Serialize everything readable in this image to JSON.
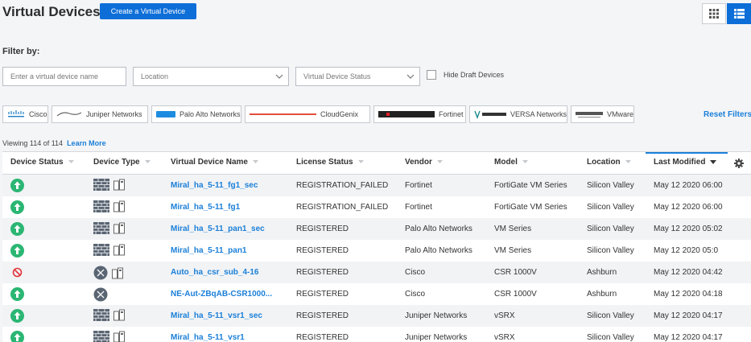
{
  "header": {
    "title": "Virtual Devices",
    "create_button": "Create a Virtual Device",
    "view_grid_icon": "grid-view-icon",
    "view_list_icon": "list-view-icon"
  },
  "filters": {
    "label": "Filter by:",
    "name_placeholder": "Enter a virtual device name",
    "location_placeholder": "Location",
    "status_placeholder": "Virtual Device Status",
    "hide_draft_label": "Hide Draft Devices",
    "reset_label": "Reset Filters",
    "vendors": [
      {
        "label": "Cisco"
      },
      {
        "label": "Juniper Networks"
      },
      {
        "label": "Palo Alto Networks"
      },
      {
        "label": "CloudGenix"
      },
      {
        "label": "Fortinet"
      },
      {
        "label": "VERSA Networks"
      },
      {
        "label": "VMware"
      }
    ]
  },
  "summary": {
    "viewing_text": "Viewing 114 of 114",
    "learn_more": "Learn More"
  },
  "table": {
    "columns": [
      "Device Status",
      "Device Type",
      "Virtual Device Name",
      "License Status",
      "Vendor",
      "Model",
      "Location",
      "Last Modified"
    ],
    "rows": [
      {
        "status": "up",
        "type": "firewall",
        "name": "Miral_ha_5-11_fg1_sec",
        "license": "REGISTRATION_FAILED",
        "vendor": "Fortinet",
        "model": "FortiGate VM Series",
        "location": "Silicon Valley",
        "modified": "May 12 2020 06:00"
      },
      {
        "status": "up",
        "type": "firewall",
        "name": "Miral_ha_5-11_fg1",
        "license": "REGISTRATION_FAILED",
        "vendor": "Fortinet",
        "model": "FortiGate VM Series",
        "location": "Silicon Valley",
        "modified": "May 12 2020 06:00"
      },
      {
        "status": "up",
        "type": "firewall",
        "name": "Miral_ha_5-11_pan1_sec",
        "license": "REGISTERED",
        "vendor": "Palo Alto Networks",
        "model": "VM Series",
        "location": "Silicon Valley",
        "modified": "May 12 2020 05:02"
      },
      {
        "status": "up",
        "type": "firewall",
        "name": "Miral_ha_5-11_pan1",
        "license": "REGISTERED",
        "vendor": "Palo Alto Networks",
        "model": "VM Series",
        "location": "Silicon Valley",
        "modified": "May 12 2020 05:0"
      },
      {
        "status": "down",
        "type": "router",
        "name": "Auto_ha_csr_sub_4-16",
        "license": "REGISTERED",
        "vendor": "Cisco",
        "model": "CSR 1000V",
        "location": "Ashburn",
        "modified": "May 12 2020 04:42"
      },
      {
        "status": "up",
        "type": "router-single",
        "name": "NE-Aut-ZBqAB-CSR1000...",
        "license": "REGISTERED",
        "vendor": "Cisco",
        "model": "CSR 1000V",
        "location": "Ashburn",
        "modified": "May 12 2020 04:18"
      },
      {
        "status": "up",
        "type": "firewall",
        "name": "Miral_ha_5-11_vsr1_sec",
        "license": "REGISTERED",
        "vendor": "Juniper Networks",
        "model": "vSRX",
        "location": "Silicon Valley",
        "modified": "May 12 2020 04:17"
      },
      {
        "status": "up",
        "type": "firewall",
        "name": "Miral_ha_5-11_vsr1",
        "license": "REGISTERED",
        "vendor": "Juniper Networks",
        "model": "vSRX",
        "location": "Silicon Valley",
        "modified": "May 12 2020 04:17"
      }
    ]
  },
  "colors": {
    "accent": "#0d6ed8",
    "link": "#1a7fd8",
    "status_up": "#2bb673",
    "status_down": "#e0353b"
  }
}
